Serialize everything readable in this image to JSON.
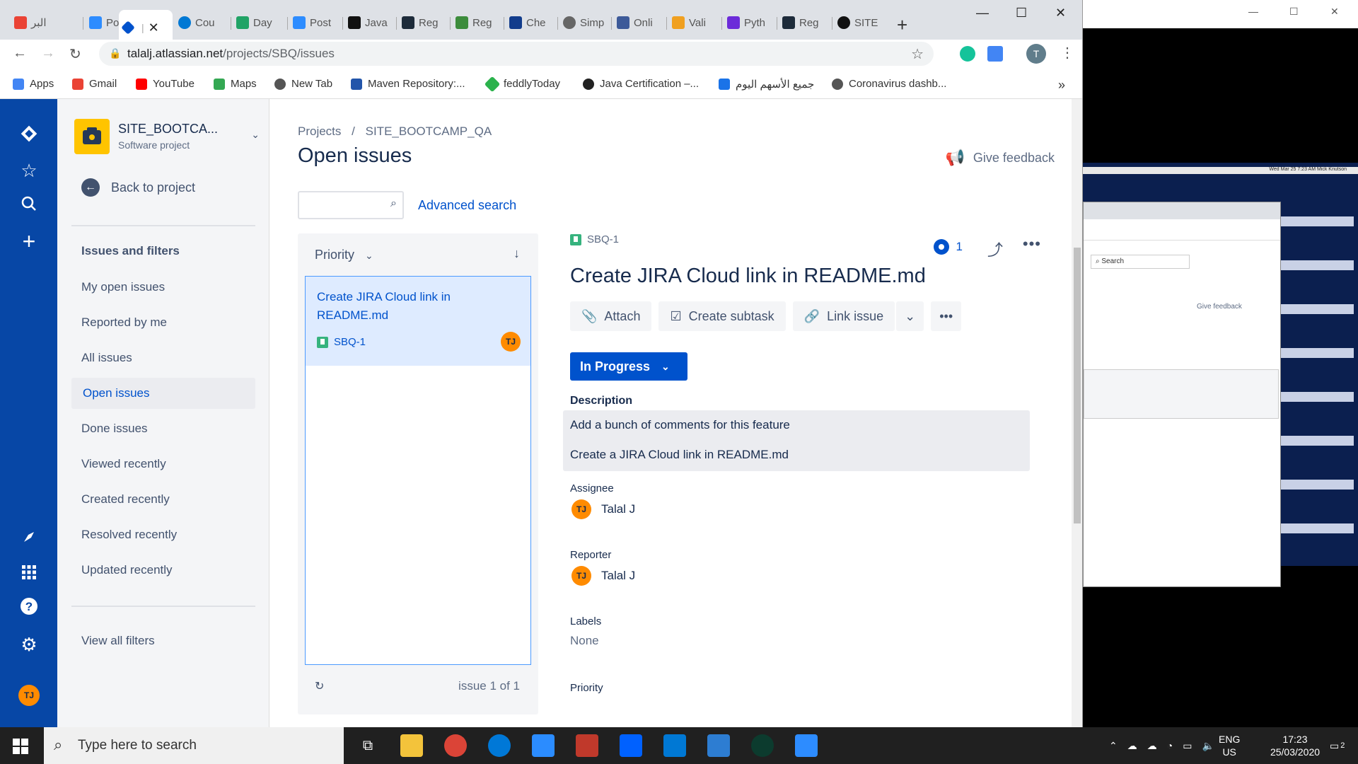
{
  "browser": {
    "tabs": [
      {
        "label": "البر",
        "color": "#ea4335"
      },
      {
        "label": "Post",
        "color": "#2d8cff"
      },
      {
        "label": "",
        "color": "#0052cc",
        "active": true
      },
      {
        "label": "Cou",
        "color": "#0078d4"
      },
      {
        "label": "Day",
        "color": "#21a366"
      },
      {
        "label": "Post",
        "color": "#2d8cff"
      },
      {
        "label": "Java",
        "color": "#111111"
      },
      {
        "label": "Reg",
        "color": "#1d2b3a"
      },
      {
        "label": "Reg",
        "color": "#3c8c3c"
      },
      {
        "label": "Che",
        "color": "#123c8c"
      },
      {
        "label": "Simp",
        "color": "#666666"
      },
      {
        "label": "Onli",
        "color": "#3d5a99"
      },
      {
        "label": "Vali",
        "color": "#f0a020"
      },
      {
        "label": "Pyth",
        "color": "#6c2bd9"
      },
      {
        "label": "Reg",
        "color": "#1d2b3a"
      },
      {
        "label": "SITE",
        "color": "#111111"
      }
    ],
    "url_host": "talalj.atlassian.net",
    "url_path": "/projects/SBQ/issues",
    "profile_initial": "T",
    "bookmarks": [
      {
        "label": "Apps",
        "color": "#4285f4"
      },
      {
        "label": "Gmail",
        "color": "#ea4335"
      },
      {
        "label": "YouTube",
        "color": "#ff0000"
      },
      {
        "label": "Maps",
        "color": "#34a853"
      },
      {
        "label": "New Tab",
        "color": "#555555"
      },
      {
        "label": "Maven Repository:...",
        "color": "#2255aa"
      },
      {
        "label": "feddlyToday",
        "color": "#2bb24c"
      },
      {
        "label": "Java Certification –...",
        "color": "#222222"
      },
      {
        "label": "جميع الأسهم اليوم",
        "color": "#1a73e8"
      },
      {
        "label": "Coronavirus dashb...",
        "color": "#555555"
      }
    ],
    "more_bookmarks": "»"
  },
  "jira": {
    "user_initials": "TJ",
    "project_name": "SITE_BOOTCA...",
    "project_type": "Software project",
    "back_label": "Back to project",
    "section_heading": "Issues and filters",
    "filters": [
      {
        "label": "My open issues"
      },
      {
        "label": "Reported by me"
      },
      {
        "label": "All issues"
      },
      {
        "label": "Open issues",
        "selected": true
      },
      {
        "label": "Done issues"
      },
      {
        "label": "Viewed recently"
      },
      {
        "label": "Created recently"
      },
      {
        "label": "Resolved recently"
      },
      {
        "label": "Updated recently"
      }
    ],
    "view_all_filters": "View all filters",
    "breadcrumb_projects": "Projects",
    "breadcrumb_sep": "/",
    "breadcrumb_project": "SITE_BOOTCAMP_QA",
    "page_title": "Open issues",
    "give_feedback": "Give feedback",
    "search_placeholder": "",
    "advanced_search": "Advanced search",
    "sort_label": "Priority",
    "issue_card": {
      "title": "Create JIRA Cloud link in README.md",
      "key": "SBQ-1",
      "assignee_initials": "TJ"
    },
    "list_count": "issue 1 of 1",
    "detail": {
      "key": "SBQ-1",
      "watchers": "1",
      "title": "Create JIRA Cloud link in README.md",
      "attach": "Attach",
      "create_subtask": "Create subtask",
      "link_issue": "Link issue",
      "status": "In Progress",
      "description_label": "Description",
      "description_line1": "Add a bunch of comments for this feature",
      "description_line2": "Create a JIRA Cloud link in README.md",
      "assignee_label": "Assignee",
      "assignee_name": "Talal J",
      "reporter_label": "Reporter",
      "reporter_name": "Talal J",
      "labels_label": "Labels",
      "labels_value": "None",
      "priority_label": "Priority"
    }
  },
  "side_window": {
    "give_feedback": "Give feedback",
    "search_label": "Search",
    "menubar_text": "Wed Mar 25 7:23 AM   Mick Knutson"
  },
  "taskbar": {
    "search_placeholder": "Type here to search",
    "lang_line1": "ENG",
    "lang_line2": "US",
    "time": "17:23",
    "date": "25/03/2020",
    "notifications": "2"
  },
  "colors": {
    "jira_nav": "#0747a6",
    "jira_blue": "#0052cc",
    "avatar_orange": "#ff8b00"
  }
}
